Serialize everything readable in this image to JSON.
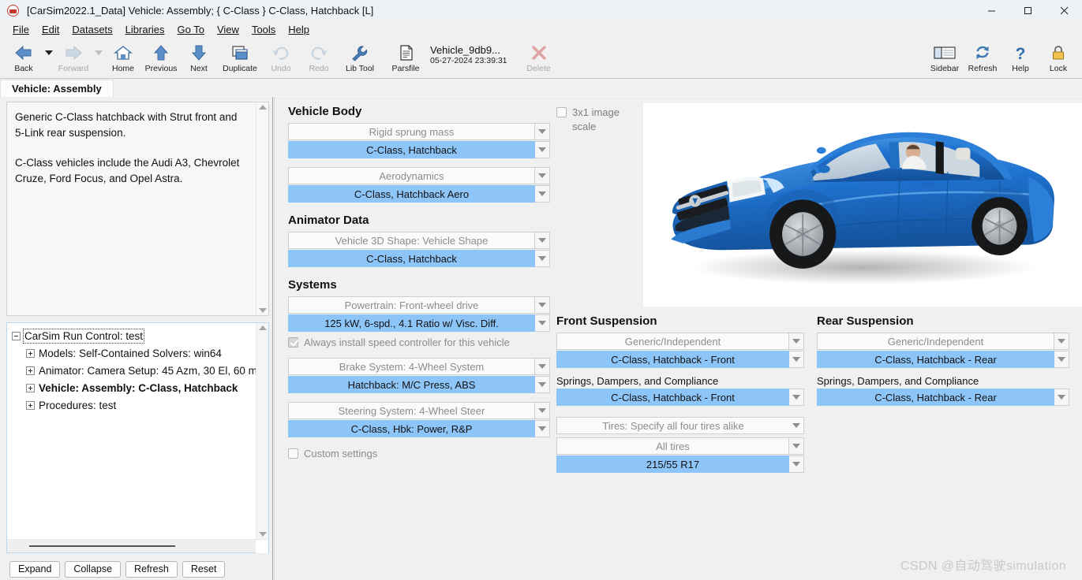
{
  "window": {
    "title": "[CarSim2022.1_Data] Vehicle: Assembly; { C-Class } C-Class, Hatchback [L]",
    "minimize": "—",
    "maximize": "□",
    "close": "✕"
  },
  "menu": {
    "items": [
      {
        "label": "File"
      },
      {
        "label": "Edit"
      },
      {
        "label": "Datasets"
      },
      {
        "label": "Libraries"
      },
      {
        "label": "Go To"
      },
      {
        "label": "View"
      },
      {
        "label": "Tools"
      },
      {
        "label": "Help"
      }
    ]
  },
  "toolbar": {
    "back": "Back",
    "forward": "Forward",
    "home": "Home",
    "previous": "Previous",
    "next": "Next",
    "duplicate": "Duplicate",
    "undo": "Undo",
    "redo": "Redo",
    "lib_tool": "Lib Tool",
    "parsfile": "Parsfile",
    "parsfile_name": "Vehicle_9db9...",
    "parsfile_date": "05-27-2024 23:39:31",
    "delete": "Delete",
    "sidebar": "Sidebar",
    "refresh": "Refresh",
    "help": "Help",
    "lock": "Lock"
  },
  "tab": {
    "label": "Vehicle: Assembly"
  },
  "description": {
    "paragraph1": "Generic C-Class hatchback with Strut front and 5-Link rear suspension.",
    "paragraph2": "C-Class vehicles include the Audi A3, Chevrolet Cruze, Ford Focus, and Opel Astra."
  },
  "tree": {
    "root": "CarSim Run Control: test",
    "children": [
      {
        "label": "Models: Self-Contained Solvers: win64",
        "bold": false
      },
      {
        "label": "Animator: Camera Setup: 45 Azm, 30 El, 60 m",
        "bold": false
      },
      {
        "label": "Vehicle: Assembly: C-Class, Hatchback",
        "bold": true
      },
      {
        "label": "Procedures: test",
        "bold": false
      }
    ]
  },
  "tree_buttons": {
    "expand": "Expand",
    "collapse": "Collapse",
    "refresh": "Refresh",
    "reset": "Reset"
  },
  "vehicle_body": {
    "title": "Vehicle Body",
    "rigid_sprung_mass_category": "Rigid sprung mass",
    "rigid_sprung_mass_value": "C-Class, Hatchback",
    "aerodynamics_category": "Aerodynamics",
    "aerodynamics_value": "C-Class, Hatchback Aero"
  },
  "animator_data": {
    "title": "Animator Data",
    "shape_category": "Vehicle 3D Shape: Vehicle Shape",
    "shape_value": "C-Class, Hatchback"
  },
  "systems": {
    "title": "Systems",
    "powertrain_category": "Powertrain: Front-wheel drive",
    "powertrain_value": "125 kW, 6-spd., 4.1 Ratio w/ Visc. Diff.",
    "speed_controller_label": "Always install speed controller for this vehicle",
    "speed_controller_checked": true,
    "brake_category": "Brake System: 4-Wheel System",
    "brake_value": "Hatchback: M/C Press, ABS",
    "steering_category": "Steering System: 4-Wheel Steer",
    "steering_value": "C-Class, Hbk: Power, R&P",
    "custom_settings_label": "Custom settings",
    "custom_settings_checked": false
  },
  "image_panel": {
    "image_checkbox_label": "3x1 image",
    "scale_label": "scale",
    "image_checked": false
  },
  "front_suspension": {
    "title": "Front Suspension",
    "kinematics_category": "Generic/Independent",
    "kinematics_value": "C-Class, Hatchback - Front",
    "springs_label": "Springs, Dampers, and Compliance",
    "springs_value": "C-Class, Hatchback - Front",
    "tires_category": "Tires: Specify all four tires alike",
    "tires_all": "All tires",
    "tires_value": "215/55 R17"
  },
  "rear_suspension": {
    "title": "Rear Suspension",
    "kinematics_category": "Generic/Independent",
    "kinematics_value": "C-Class, Hatchback - Rear",
    "springs_label": "Springs, Dampers, and Compliance",
    "springs_value": "C-Class, Hatchback - Rear"
  },
  "watermark": {
    "text": "CSDN @自动驾驶simulation"
  },
  "colors": {
    "selected_row": "#8ec5f8",
    "category_row": "#fafafa",
    "window_bg": "#f0f0f0",
    "car_body": "#1f72d0"
  }
}
